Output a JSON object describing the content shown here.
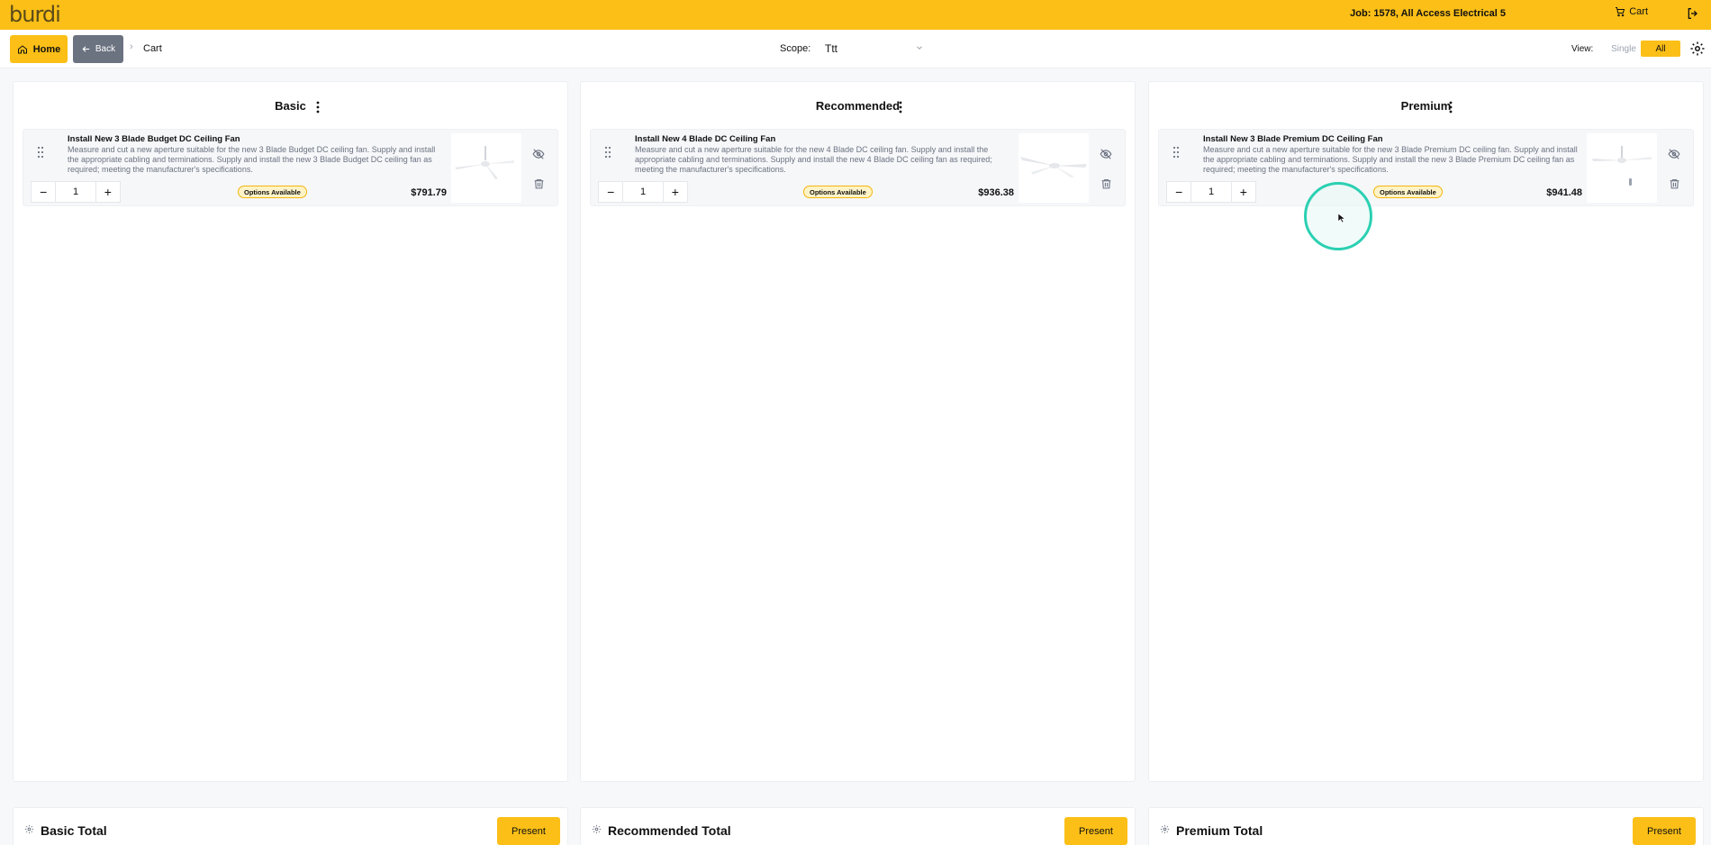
{
  "brand": {
    "logo": "burdi",
    "accent": "#fbbf17"
  },
  "topbar": {
    "job": "Job: 1578, All Access Electrical 5",
    "cart": "Cart"
  },
  "subbar": {
    "home": "Home",
    "back": "Back",
    "breadcrumb": "Cart",
    "scope_label": "Scope:",
    "scope_value": "Ttt",
    "view_label": "View:",
    "view_single": "Single",
    "view_all": "All"
  },
  "columns": [
    {
      "title": "Basic",
      "item": {
        "title": "Install New 3 Blade Budget DC Ceiling Fan",
        "description": "Measure and cut a new aperture suitable for the new 3 Blade Budget DC ceiling fan. Supply and install the appropriate cabling and terminations. Supply and install the new 3 Blade Budget DC ceiling fan as required; meeting the manufacturer's specifications.",
        "quantity": "1",
        "badge": "Options Available",
        "price": "$791.79"
      },
      "total_label": "Basic Total",
      "present": "Present"
    },
    {
      "title": "Recommended",
      "item": {
        "title": "Install New 4 Blade DC Ceiling Fan",
        "description": "Measure and cut a new aperture suitable for the new 4 Blade DC ceiling fan. Supply and install the appropriate cabling and terminations. Supply and install the new 4 Blade DC ceiling fan as required; meeting the manufacturer's specifications.",
        "quantity": "1",
        "badge": "Options Available",
        "price": "$936.38"
      },
      "total_label": "Recommended Total",
      "present": "Present"
    },
    {
      "title": "Premium",
      "item": {
        "title": "Install New 3 Blade Premium DC Ceiling Fan",
        "description": "Measure and cut a new aperture suitable for the new 3 Blade Premium DC ceiling fan. Supply and install the appropriate cabling and terminations. Supply and install the new 3 Blade Premium DC ceiling fan as required; meeting the manufacturer's specifications.",
        "quantity": "1",
        "badge": "Options Available",
        "price": "$941.48"
      },
      "total_label": "Premium Total",
      "present": "Present"
    }
  ],
  "icons": {
    "cart": "cart-icon",
    "logout": "logout-icon",
    "home": "home-icon",
    "back": "arrow-left-icon",
    "settings": "gear-icon",
    "menu": "kebab-menu-icon",
    "drag": "drag-handle-icon",
    "hide": "eye-off-icon",
    "delete": "trash-icon"
  }
}
